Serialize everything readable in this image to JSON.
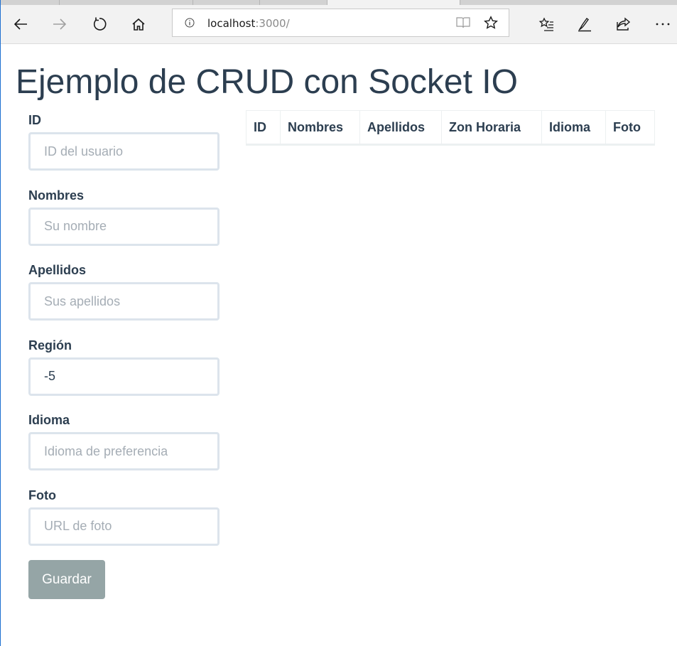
{
  "browser": {
    "url_host": "localhost",
    "url_port": ":3000/",
    "icons": [
      "back-icon",
      "forward-icon",
      "refresh-icon",
      "home-icon",
      "info-icon",
      "reading-view-icon",
      "favorite-star-icon",
      "favorites-list-icon",
      "pen-icon",
      "share-icon",
      "more-icon"
    ]
  },
  "page": {
    "title": "Ejemplo de CRUD con Socket IO"
  },
  "form": {
    "fields": [
      {
        "label": "ID",
        "placeholder": "ID del usuario",
        "value": ""
      },
      {
        "label": "Nombres",
        "placeholder": "Su nombre",
        "value": ""
      },
      {
        "label": "Apellidos",
        "placeholder": "Sus apellidos",
        "value": ""
      },
      {
        "label": "Región",
        "placeholder": "",
        "value": "-5"
      },
      {
        "label": "Idioma",
        "placeholder": "Idioma de preferencia",
        "value": ""
      },
      {
        "label": "Foto",
        "placeholder": "URL de foto",
        "value": ""
      }
    ],
    "save_label": "Guardar"
  },
  "table": {
    "headers": [
      "ID",
      "Nombres",
      "Apellidos",
      "Zon Horaria",
      "Idioma",
      "Foto"
    ],
    "rows": []
  },
  "colors": {
    "heading_text": "#2c3e50",
    "button_bg": "#95a5a6",
    "input_border": "#dce4ec",
    "window_accent": "#1e6fd0"
  }
}
